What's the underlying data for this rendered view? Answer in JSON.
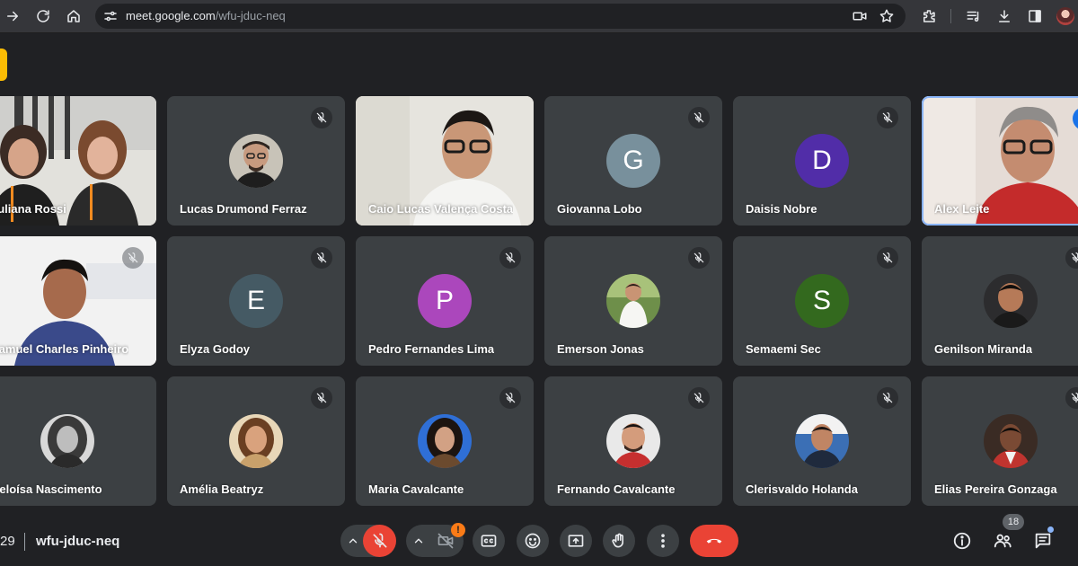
{
  "browser": {
    "url_host": "meet.google.com",
    "url_path": "/wfu-jduc-neq"
  },
  "tiles": [
    {
      "name": "Juliana Rossi",
      "type": "video",
      "muted": false
    },
    {
      "name": "Lucas Drumond Ferraz",
      "type": "photo",
      "muted": true
    },
    {
      "name": "Caio Lucas Valença Costa",
      "type": "video",
      "muted": false
    },
    {
      "name": "Giovanna Lobo",
      "type": "letter",
      "letter": "G",
      "color": "#78909c",
      "muted": true
    },
    {
      "name": "Daisis Nobre",
      "type": "letter",
      "letter": "D",
      "color": "#512da8",
      "muted": true
    },
    {
      "name": "Alex Leite",
      "type": "video",
      "muted": false,
      "active": true
    },
    {
      "name": "Samuel Charles Pinheiro",
      "type": "video",
      "muted": true
    },
    {
      "name": "Elyza Godoy",
      "type": "letter",
      "letter": "E",
      "color": "#455a64",
      "muted": true
    },
    {
      "name": "Pedro Fernandes Lima",
      "type": "letter",
      "letter": "P",
      "color": "#ab47bc",
      "muted": true
    },
    {
      "name": "Emerson Jonas",
      "type": "photo",
      "muted": true
    },
    {
      "name": "Semaemi Sec",
      "type": "letter",
      "letter": "S",
      "color": "#33691e",
      "muted": true
    },
    {
      "name": "Genilson Miranda",
      "type": "photo",
      "muted": true
    },
    {
      "name": "Heloísa Nascimento",
      "type": "photo",
      "muted": true
    },
    {
      "name": "Amélia Beatryz",
      "type": "photo",
      "muted": true
    },
    {
      "name": "Maria Cavalcante",
      "type": "photo",
      "muted": true
    },
    {
      "name": "Fernando Cavalcante",
      "type": "photo",
      "muted": true
    },
    {
      "name": "Clerisvaldo Holanda",
      "type": "photo",
      "muted": true
    },
    {
      "name": "Elias Pereira Gonzaga",
      "type": "photo",
      "muted": true
    }
  ],
  "bottom": {
    "time": "29",
    "meeting_code": "wfu-jduc-neq",
    "camera_alert": "!",
    "participants_count": "18"
  },
  "colors": {
    "background": "#202124",
    "tile": "#3c4043",
    "mic_off_red": "#ea4335",
    "active_outline": "#8ab4f8"
  }
}
